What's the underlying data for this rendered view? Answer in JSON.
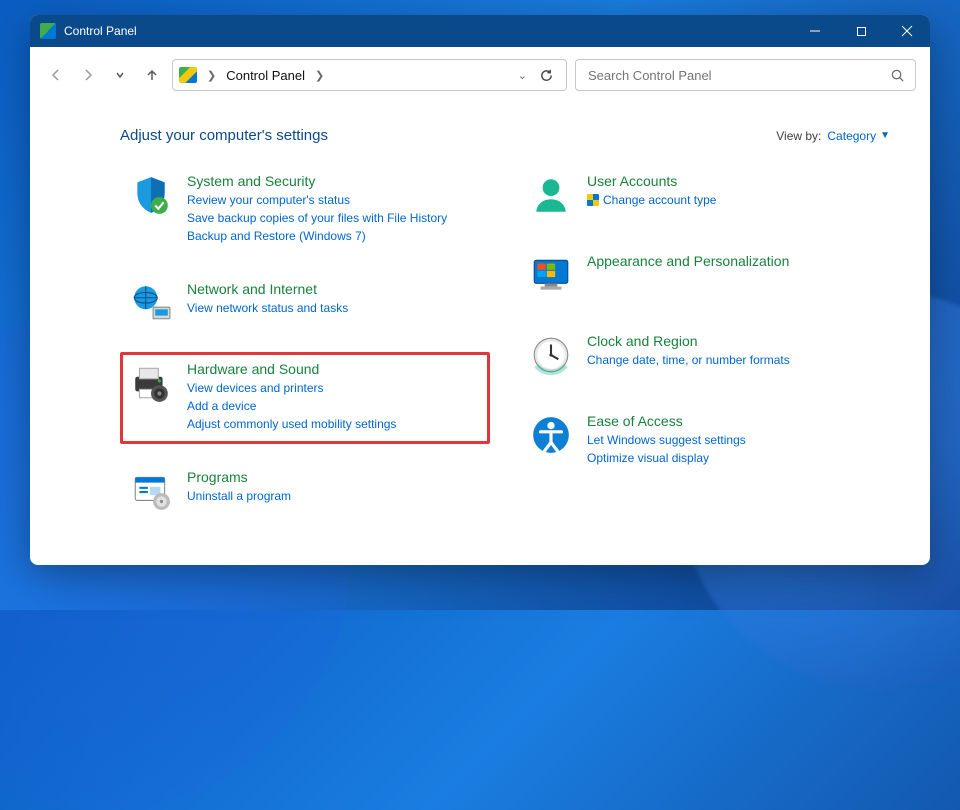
{
  "window": {
    "title": "Control Panel"
  },
  "address": {
    "location": "Control Panel"
  },
  "search": {
    "placeholder": "Search Control Panel"
  },
  "header": {
    "adjust_title": "Adjust your computer's settings",
    "view_by_label": "View by:",
    "view_by_value": "Category"
  },
  "categories": {
    "left": [
      {
        "title": "System and Security",
        "links": [
          "Review your computer's status",
          "Save backup copies of your files with File History",
          "Backup and Restore (Windows 7)"
        ],
        "icon": "shield",
        "highlighted": false
      },
      {
        "title": "Network and Internet",
        "links": [
          "View network status and tasks"
        ],
        "icon": "network",
        "highlighted": false
      },
      {
        "title": "Hardware and Sound",
        "links": [
          "View devices and printers",
          "Add a device",
          "Adjust commonly used mobility settings"
        ],
        "icon": "printer",
        "highlighted": true
      },
      {
        "title": "Programs",
        "links": [
          "Uninstall a program"
        ],
        "icon": "programs",
        "highlighted": false
      }
    ],
    "right": [
      {
        "title": "User Accounts",
        "links": [
          "Change account type"
        ],
        "icon": "user",
        "shield_on_first_link": true,
        "highlighted": false
      },
      {
        "title": "Appearance and Personalization",
        "links": [],
        "icon": "monitor",
        "highlighted": false
      },
      {
        "title": "Clock and Region",
        "links": [
          "Change date, time, or number formats"
        ],
        "icon": "clock",
        "highlighted": false
      },
      {
        "title": "Ease of Access",
        "links": [
          "Let Windows suggest settings",
          "Optimize visual display"
        ],
        "icon": "access",
        "highlighted": false
      }
    ]
  }
}
